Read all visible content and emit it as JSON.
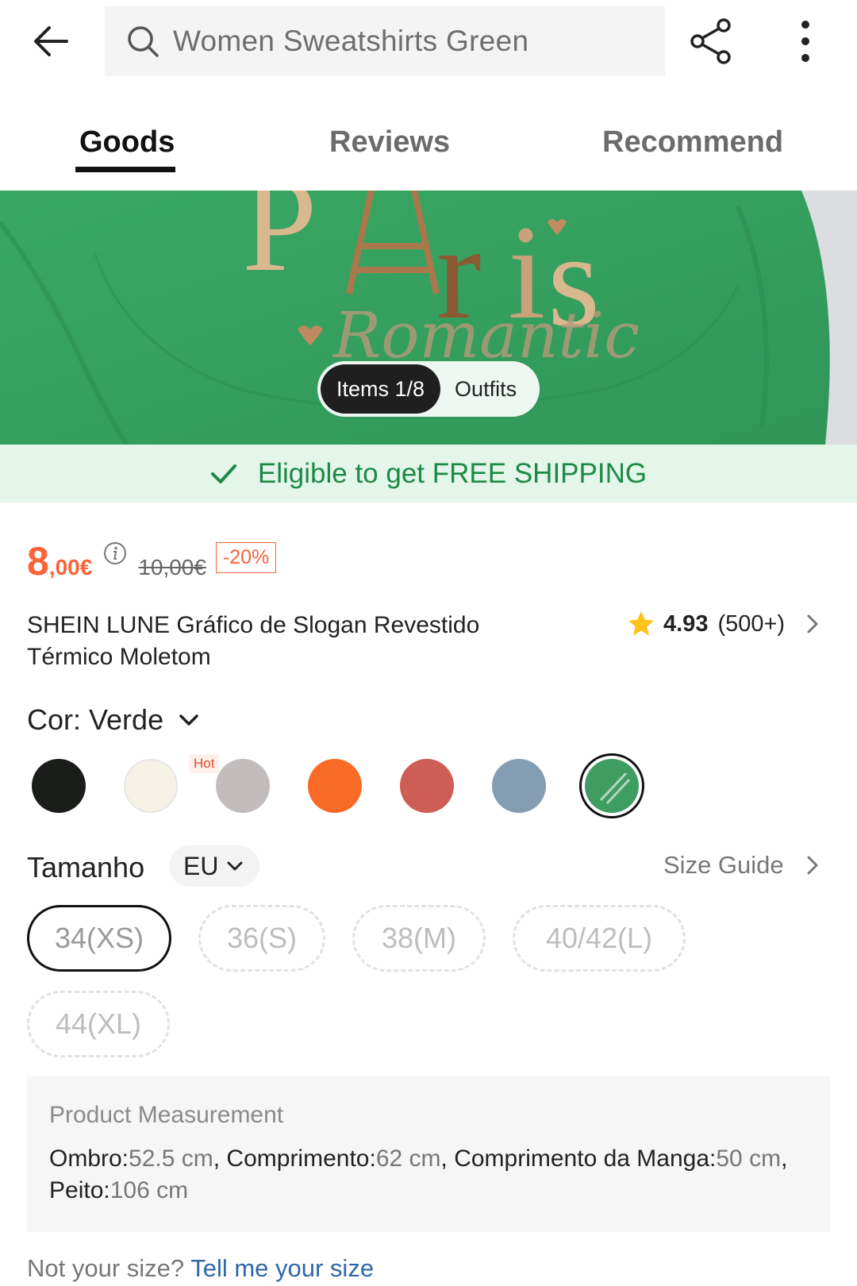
{
  "search": {
    "query": "Women Sweatshirts Green"
  },
  "tabs": [
    {
      "label": "Goods",
      "active": true
    },
    {
      "label": "Reviews",
      "active": false
    },
    {
      "label": "Recommend",
      "active": false
    }
  ],
  "gallery": {
    "items_label": "Items 1/8",
    "outfits_label": "Outfits",
    "image_text": "PAris",
    "image_script": "Romantic"
  },
  "shipping": {
    "text": "Eligible to get FREE SHIPPING",
    "color": "#1c8a45",
    "background": "#e4f5ea"
  },
  "price": {
    "integer": "8",
    "decimal": ",00€",
    "original": "10,00€",
    "discount": "-20%",
    "accent_color": "#fa6338"
  },
  "product": {
    "title": "SHEIN LUNE Gráfico de Slogan Revestido Térmico Moletom",
    "rating": "4.93",
    "rating_count": "(500+)"
  },
  "color": {
    "label": "Cor: Verde",
    "hot_tag": "Hot",
    "swatches": [
      {
        "name": "black",
        "hex": "#1b1d1b",
        "selected": false
      },
      {
        "name": "cream",
        "hex": "#f7f2e6",
        "selected": false
      },
      {
        "name": "light-grey",
        "hex": "#c3bcbc",
        "selected": false
      },
      {
        "name": "orange",
        "hex": "#f86a25",
        "selected": false
      },
      {
        "name": "brick-red",
        "hex": "#cd5d55",
        "selected": false
      },
      {
        "name": "dusty-blue",
        "hex": "#859db3",
        "selected": false
      },
      {
        "name": "green",
        "hex": "#3f9d62",
        "selected": true
      }
    ]
  },
  "size": {
    "label": "Tamanho",
    "region": "EU",
    "guide_label": "Size Guide",
    "options": [
      {
        "label": "34(XS)",
        "selected": true
      },
      {
        "label": "36(S)",
        "selected": false
      },
      {
        "label": "38(M)",
        "selected": false
      },
      {
        "label": "40/42(L)",
        "selected": false
      },
      {
        "label": "44(XL)",
        "selected": false
      }
    ]
  },
  "measurement": {
    "title": "Product Measurement",
    "shoulder_label": "Ombro:",
    "shoulder_value": "52.5 cm",
    "length_label": "Comprimento:",
    "length_value": "62 cm",
    "sleeve_label": "Comprimento da Manga:",
    "sleeve_value": "50 cm",
    "bust_label": "Peito:",
    "bust_value": "106 cm"
  },
  "fit_prompt": {
    "question": "Not your size?",
    "link": "Tell me your size"
  }
}
